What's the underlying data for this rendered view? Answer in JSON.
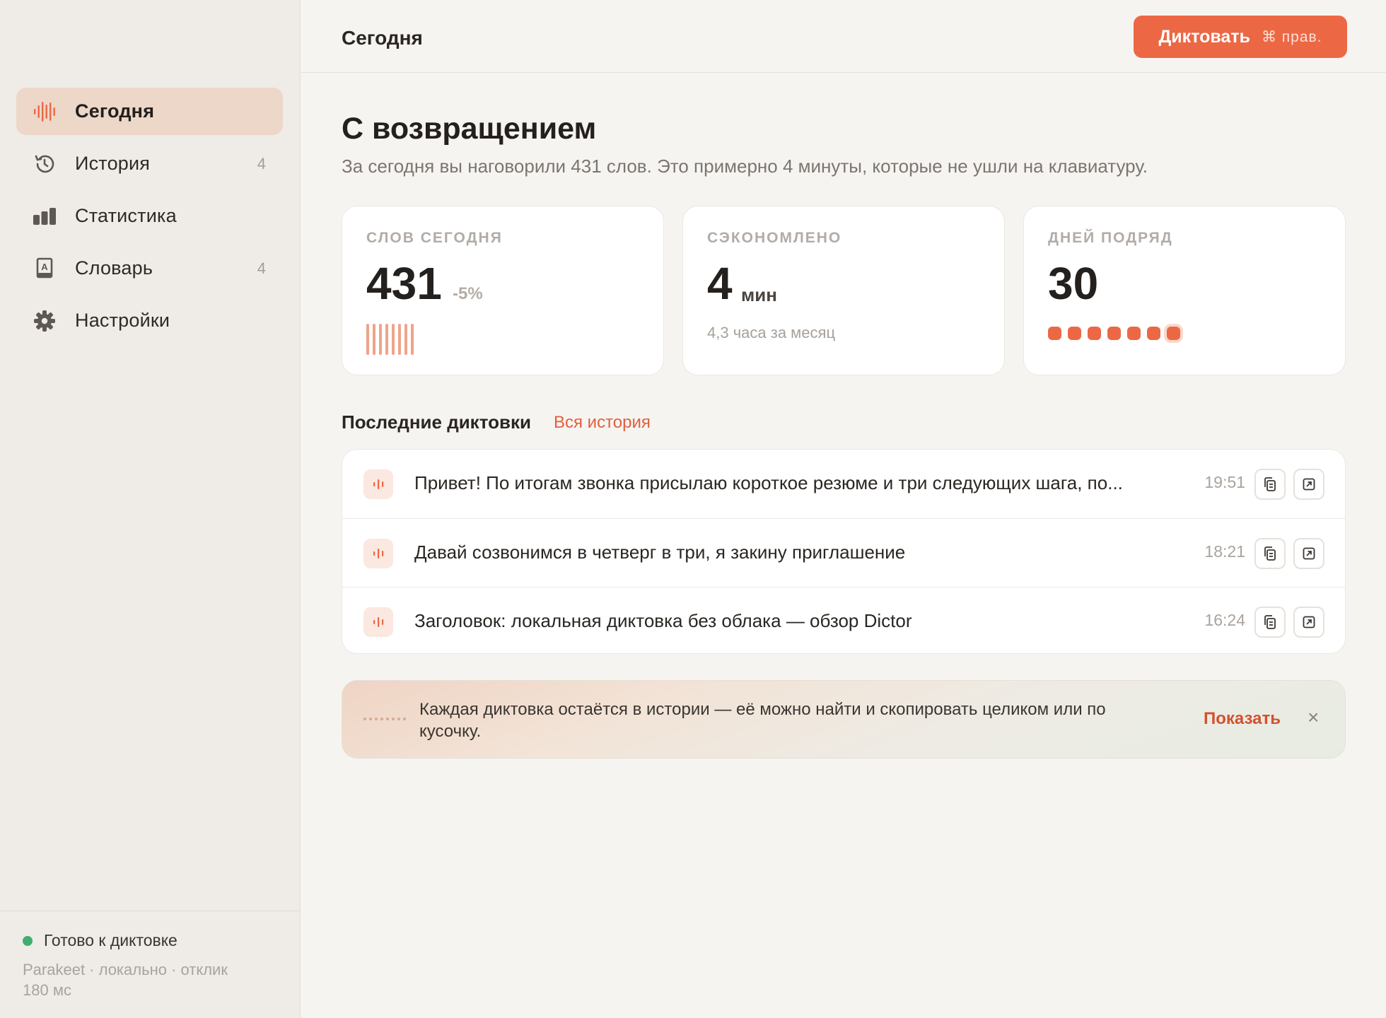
{
  "sidebar": {
    "items": [
      {
        "label": "Сегодня",
        "icon": "waveform-icon",
        "count": ""
      },
      {
        "label": "История",
        "icon": "history-icon",
        "count": "4"
      },
      {
        "label": "Статистика",
        "icon": "bar-chart-icon",
        "count": ""
      },
      {
        "label": "Словарь",
        "icon": "dictionary-icon",
        "count": "4"
      },
      {
        "label": "Настройки",
        "icon": "gear-icon",
        "count": ""
      }
    ],
    "footer": {
      "status": "Готово к диктовке",
      "model": "Parakeet · локально · отклик 180 мс"
    }
  },
  "header": {
    "title": "Сегодня",
    "dictate_label": "Диктовать",
    "dictate_shortcut": "⌘ прав."
  },
  "main": {
    "greeting": "С возвращением",
    "subtitle": "За сегодня вы наговорили 431 слов. Это примерно 4 минуты, которые не ушли на клавиатуру."
  },
  "stats": {
    "words": {
      "label": "СЛОВ СЕГОДНЯ",
      "value": "431",
      "delta": "-5%"
    },
    "saved": {
      "label": "СЭКОНОМЛЕНО",
      "value": "4",
      "unit": "мин",
      "note": "4,3 часа за месяц"
    },
    "streak": {
      "label": "ДНЕЙ ПОДРЯД",
      "value": "30",
      "days_shown": 7
    }
  },
  "recent": {
    "title": "Последние диктовки",
    "link": "Вся история",
    "items": [
      {
        "text": "Привет! По итогам звонка присылаю короткое резюме и три следующих шага, по...",
        "time": "19:51"
      },
      {
        "text": "Давай созвонимся в четверг в три, я закину приглашение",
        "time": "18:21"
      },
      {
        "text": "Заголовок: локальная диктовка без облака — обзор Dictor",
        "time": "16:24"
      }
    ]
  },
  "tip": {
    "text": "Каждая диктовка остаётся в истории — её можно найти и скопировать целиком или по кусочку.",
    "action": "Показать",
    "close": "×"
  },
  "colors": {
    "accent": "#ec6845",
    "sidebar_active": "#ecd7c8",
    "status_ok": "#3fae6e"
  }
}
